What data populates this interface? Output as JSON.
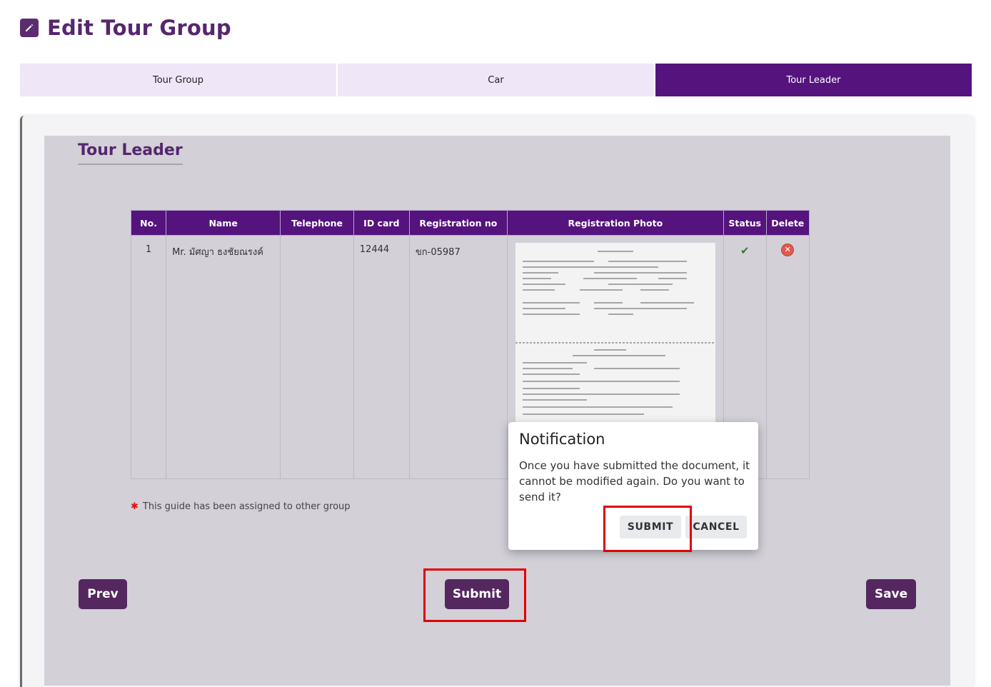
{
  "header": {
    "title": "Edit Tour Group",
    "icon": "edit-icon"
  },
  "tabs": [
    {
      "label": "Tour Group",
      "active": false
    },
    {
      "label": "Car",
      "active": false
    },
    {
      "label": "Tour Leader",
      "active": true
    }
  ],
  "section": {
    "title": "Tour Leader"
  },
  "table": {
    "headers": [
      "No.",
      "Name",
      "Telephone",
      "ID card",
      "Registration no",
      "Registration Photo",
      "Status",
      "Delete"
    ],
    "rows": [
      {
        "no": "1",
        "name": "Mr. มัศญา ธงชัยณรงค์",
        "telephone": "",
        "id_card": "12444",
        "registration_no": "ขก-05987",
        "photo": "document-thumbnail",
        "status": "check-icon",
        "delete": "delete-icon"
      }
    ]
  },
  "note": {
    "text": "This guide has been assigned to other group"
  },
  "buttons": {
    "prev": "Prev",
    "submit": "Submit",
    "save": "Save"
  },
  "dialog": {
    "title": "Notification",
    "message": "Once you have submitted the document, it cannot be modified again. Do you want to send it?",
    "submit": "SUBMIT",
    "cancel": "CANCEL"
  },
  "colors": {
    "primary": "#55137e",
    "button": "#54275f",
    "title": "#56266e",
    "highlight": "#e00000"
  }
}
